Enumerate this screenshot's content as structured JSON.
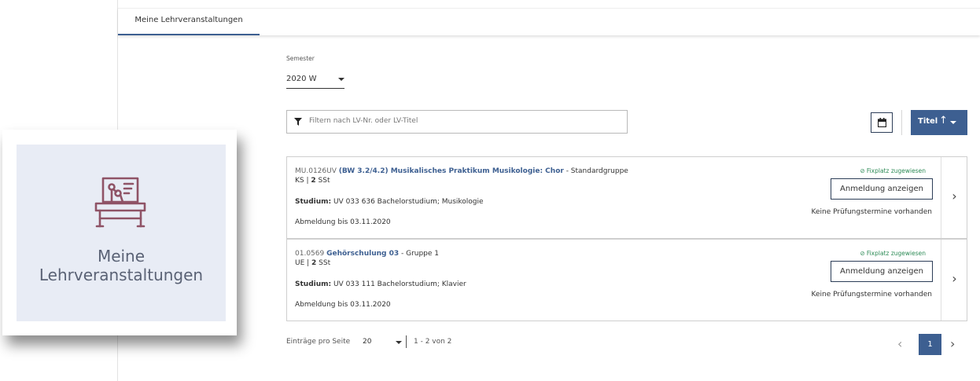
{
  "tabs": {
    "active_label": "Meine Lehrveranstaltungen"
  },
  "semester": {
    "label": "Semester",
    "value": "2020 W"
  },
  "filter": {
    "placeholder": "Filtern nach LV-Nr. oder LV-Titel"
  },
  "sort": {
    "label": "Titel",
    "arrow": "↑"
  },
  "courses": [
    {
      "number": "MU.0126UV",
      "title": "(BW 3.2/4.2) Musikalisches Praktikum Musikologie: Chor",
      "group": " - Standardgruppe",
      "type": "KS",
      "ssts_value": "2",
      "ssts_unit": " SSt",
      "studium_label": "Studium:",
      "studium_value": " UV 033 636 Bachelorstudium; Musikologie",
      "deregistration": "Abmeldung bis 03.11.2020",
      "status": "Fixplatz zugewiesen",
      "button": "Anmeldung anzeigen",
      "exam_info": "Keine Prüfungstermine vorhanden"
    },
    {
      "number": "01.0569",
      "title": "Gehörschulung 03",
      "group": " - Gruppe 1",
      "type": "UE",
      "ssts_value": "2",
      "ssts_unit": " SSt",
      "studium_label": "Studium:",
      "studium_value": " UV 033 111 Bachelorstudium; Klavier",
      "deregistration": "Abmeldung bis 03.11.2020",
      "status": "Fixplatz zugewiesen",
      "button": "Anmeldung anzeigen",
      "exam_info": "Keine Prüfungstermine vorhanden"
    }
  ],
  "pagination": {
    "per_page_label": "Einträge pro Seite",
    "per_page_value": "20",
    "range": "1 - 2 von 2",
    "current_page": "1"
  },
  "tile": {
    "line1": "Meine",
    "line2": "Lehrveranstaltungen"
  },
  "colors": {
    "accent": "#3d5f91",
    "success": "#2e8b57",
    "tile_bg": "#e8ecf5"
  }
}
